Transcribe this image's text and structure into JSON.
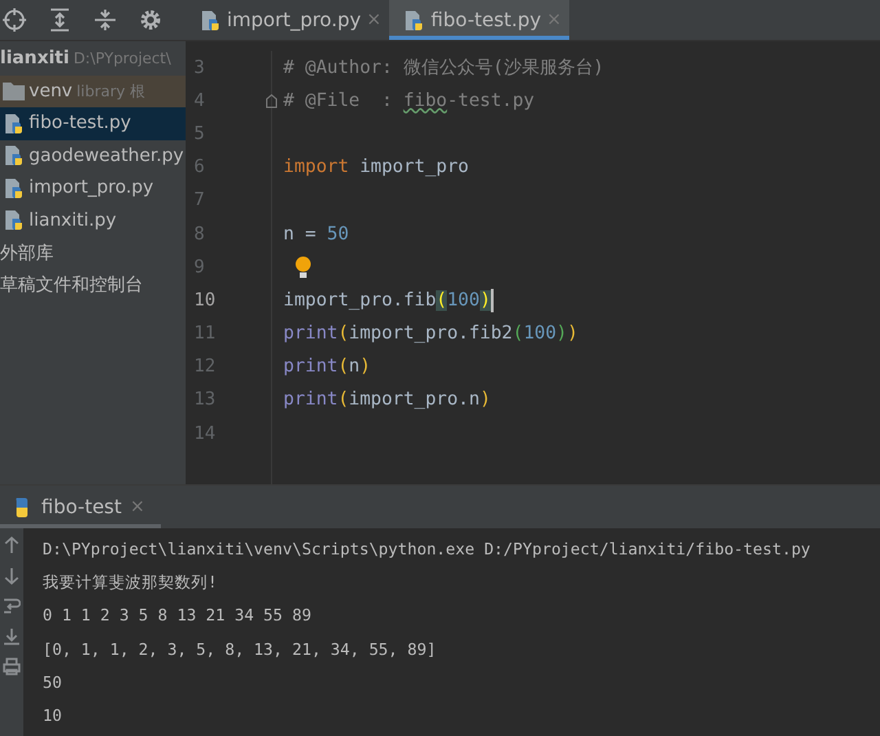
{
  "project_tree": {
    "items": [
      {
        "kind": "root",
        "name": "lianxiti",
        "detail": "D:\\PYproject\\",
        "selected": false
      },
      {
        "kind": "folder",
        "name": "venv",
        "detail": "library 根",
        "selected": false
      },
      {
        "kind": "file",
        "name": "fibo-test.py",
        "selected": true
      },
      {
        "kind": "file",
        "name": "gaodeweather.py",
        "selected": false
      },
      {
        "kind": "file",
        "name": "import_pro.py",
        "selected": false
      },
      {
        "kind": "file",
        "name": "lianxiti.py",
        "selected": false
      },
      {
        "kind": "library",
        "name": "外部库",
        "selected": false
      },
      {
        "kind": "scratch",
        "name": "草稿文件和控制台",
        "selected": false
      }
    ]
  },
  "tabs": [
    {
      "label": "import_pro.py",
      "close": "×",
      "selected": false
    },
    {
      "label": "fibo-test.py",
      "close": "×",
      "selected": true
    }
  ],
  "editor": {
    "lines": [
      {
        "number": "3",
        "current": false,
        "tokens": [
          {
            "kind": "comment",
            "text": "# @Author: 微信公众号(沙果服务台)"
          }
        ]
      },
      {
        "number": "4",
        "current": false,
        "fold": true,
        "tokens": [
          {
            "kind": "comment",
            "text": "# @File  : "
          },
          {
            "kind": "typo",
            "text": "fibo"
          },
          {
            "kind": "comment",
            "text": "-test.py"
          }
        ]
      },
      {
        "number": "5",
        "current": false
      },
      {
        "number": "6",
        "current": false,
        "tokens": [
          {
            "kind": "keyword",
            "text": "import"
          },
          {
            "kind": "plain",
            "text": " import_pro"
          }
        ]
      },
      {
        "number": "7",
        "current": false
      },
      {
        "number": "8",
        "current": false,
        "tokens": [
          {
            "kind": "plain",
            "text": "n = "
          },
          {
            "kind": "number",
            "text": "50"
          }
        ]
      },
      {
        "number": "9",
        "current": false,
        "bulb": true
      },
      {
        "number": "10",
        "current": true,
        "caret": true,
        "tokens": [
          {
            "kind": "plain",
            "text": "import_pro.fib"
          },
          {
            "kind": "match",
            "text": "("
          },
          {
            "kind": "number",
            "text": "100"
          },
          {
            "kind": "match",
            "text": ")"
          }
        ]
      },
      {
        "number": "11",
        "current": false,
        "tokens": [
          {
            "kind": "builtin",
            "text": "print"
          },
          {
            "kind": "paren",
            "text": "("
          },
          {
            "kind": "plain",
            "text": "import_pro.fib2"
          },
          {
            "kind": "paren2",
            "text": "("
          },
          {
            "kind": "number",
            "text": "100"
          },
          {
            "kind": "paren2",
            "text": ")"
          },
          {
            "kind": "paren",
            "text": ")"
          }
        ]
      },
      {
        "number": "12",
        "current": false,
        "tokens": [
          {
            "kind": "builtin",
            "text": "print"
          },
          {
            "kind": "paren",
            "text": "("
          },
          {
            "kind": "plain",
            "text": "n"
          },
          {
            "kind": "paren",
            "text": ")"
          }
        ]
      },
      {
        "number": "13",
        "current": false,
        "tokens": [
          {
            "kind": "builtin",
            "text": "print"
          },
          {
            "kind": "paren",
            "text": "("
          },
          {
            "kind": "plain",
            "text": "import_pro.n"
          },
          {
            "kind": "paren",
            "text": ")"
          }
        ]
      },
      {
        "number": "14",
        "current": false
      }
    ]
  },
  "run_panel": {
    "tab": {
      "label": "fibo-test",
      "close": "×",
      "selected": true
    },
    "output": [
      "D:\\PYproject\\lianxiti\\venv\\Scripts\\python.exe D:/PYproject/lianxiti/fibo-test.py",
      "我要计算斐波那契数列!",
      "0 1 1 2 3 5 8 13 21 34 55 89",
      "[0, 1, 1, 2, 3, 5, 8, 13, 21, 34, 55, 89]",
      "50",
      "10"
    ]
  }
}
